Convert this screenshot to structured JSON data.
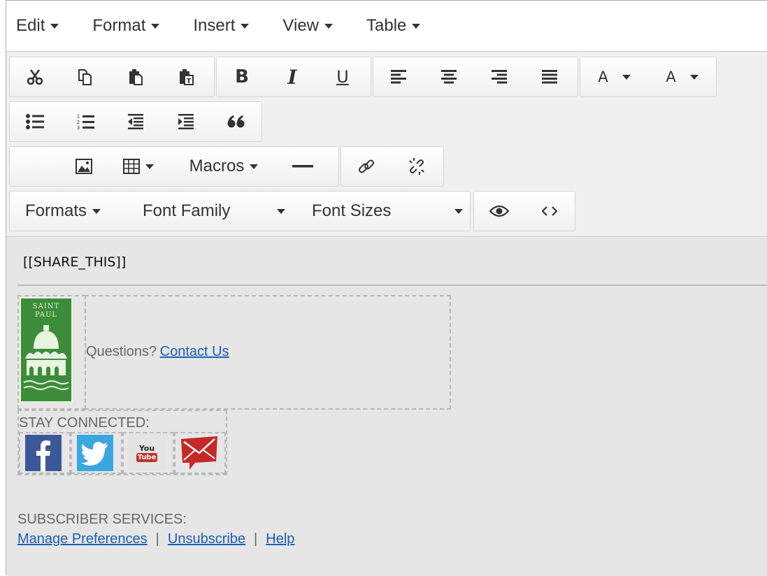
{
  "menubar": {
    "items": [
      {
        "label": "Edit"
      },
      {
        "label": "Format"
      },
      {
        "label": "Insert"
      },
      {
        "label": "View"
      },
      {
        "label": "Table"
      }
    ]
  },
  "toolbar": {
    "bold_label": "B",
    "italic_label": "I",
    "underline_label": "U",
    "text_color_label": "A",
    "bg_color_label": "A",
    "blockquote_label": "66",
    "macros_label": "Macros",
    "formats_label": "Formats",
    "font_family_label": "Font Family",
    "font_sizes_label": "Font Sizes"
  },
  "content": {
    "share_placeholder": "[[SHARE_THIS]]",
    "logo_text_line1": "SAINT",
    "logo_text_line2": "PAUL",
    "questions_text": "Questions?",
    "contact_link": "Contact Us",
    "stay_connected": "STAY CONNECTED:",
    "social": [
      {
        "name": "facebook",
        "color": "#3b5998"
      },
      {
        "name": "twitter",
        "color": "#3aa7e0"
      },
      {
        "name": "youtube",
        "color": "#c4302b",
        "text_top": "You",
        "text_bottom": "Tube"
      },
      {
        "name": "email",
        "color": "#c62828"
      }
    ],
    "subscriber_services": "SUBSCRIBER SERVICES:",
    "links": {
      "manage": "Manage Preferences",
      "separator": "|",
      "unsubscribe": "Unsubscribe",
      "help": "Help"
    }
  },
  "colors": {
    "link": "#1a5eb8",
    "logo_green": "#3c8d3a",
    "toolbar_bg": "#f0f0f0"
  }
}
